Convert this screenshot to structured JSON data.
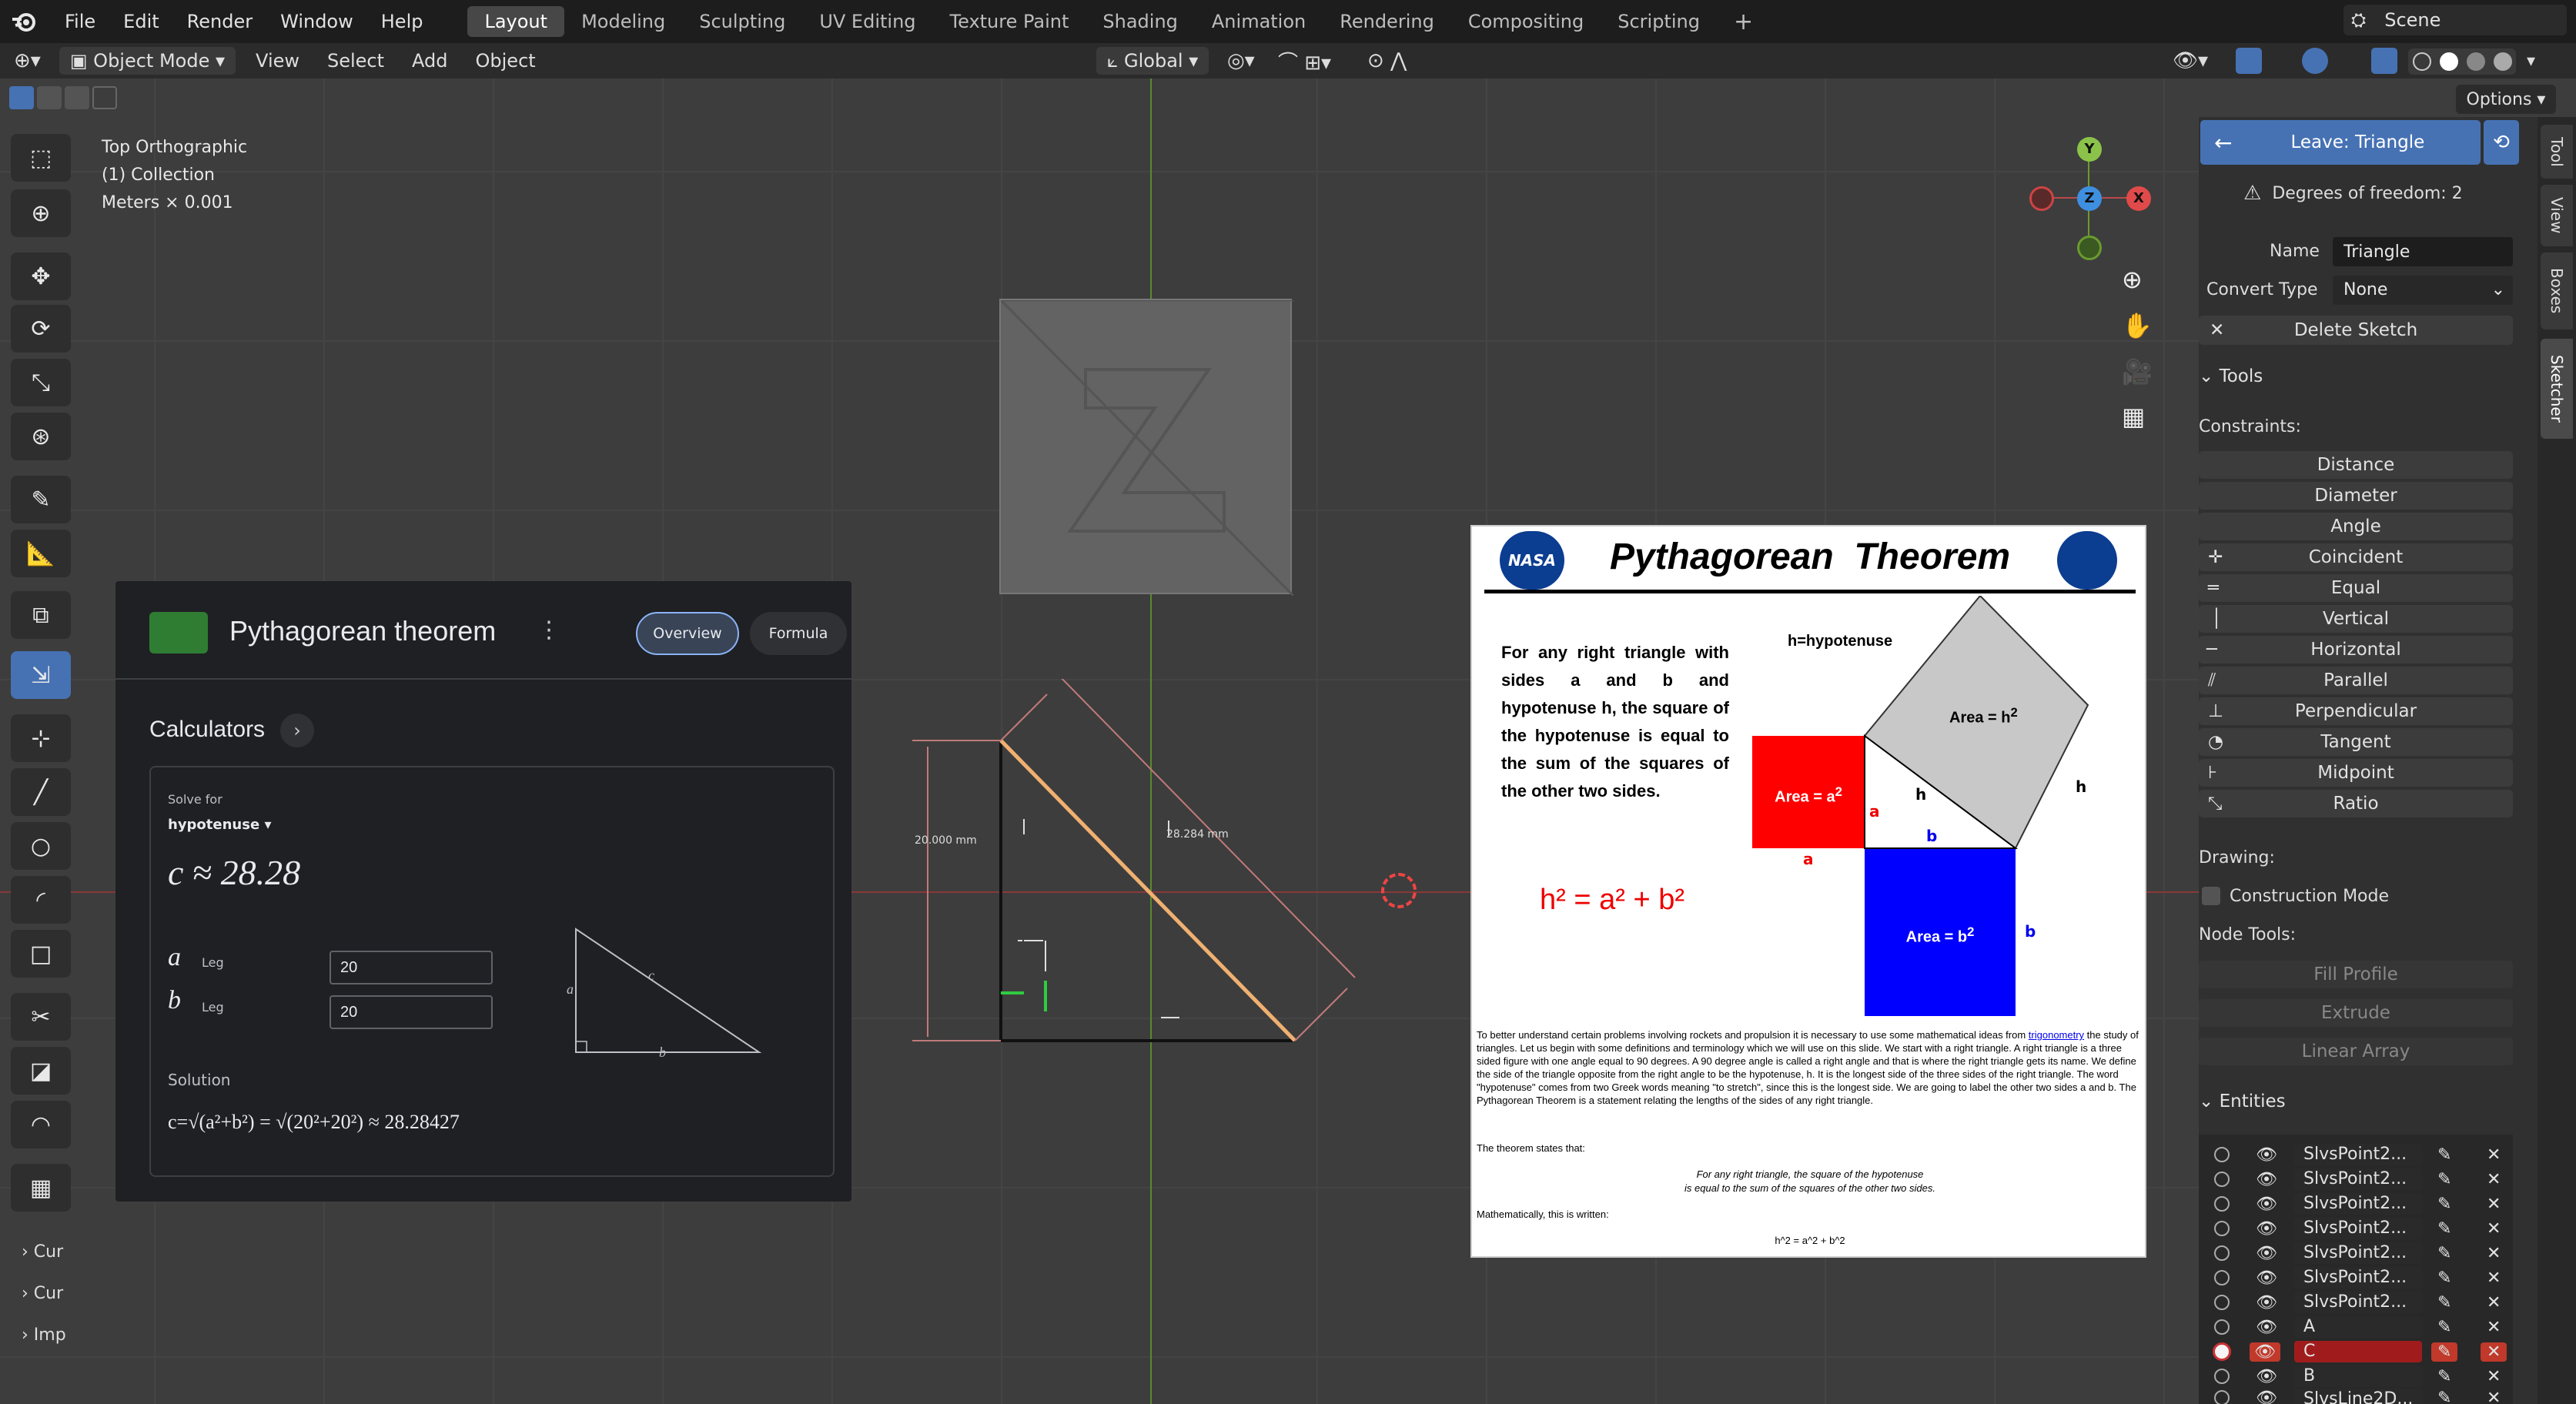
{
  "topbar": {
    "menu": [
      "File",
      "Edit",
      "Render",
      "Window",
      "Help"
    ],
    "workspaces": [
      "Layout",
      "Modeling",
      "Sculpting",
      "UV Editing",
      "Texture Paint",
      "Shading",
      "Animation",
      "Rendering",
      "Compositing",
      "Scripting"
    ],
    "active_workspace": "Layout",
    "scene_label": "Scene"
  },
  "header": {
    "mode": "Object Mode",
    "menus": [
      "View",
      "Select",
      "Add",
      "Object"
    ],
    "transform_orientation": "Global",
    "options_label": "Options"
  },
  "viewport": {
    "overlay_lines": [
      "Top Orthographic",
      "(1) Collection",
      "Meters × 0.001"
    ],
    "dim_vertical": "20.000 mm",
    "dim_diagonal": "28.284 mm",
    "gizmo": {
      "y": "Y",
      "z": "Z",
      "x": "X"
    },
    "bottom_items": [
      "Cur",
      "Cur",
      "Imp"
    ]
  },
  "google_card": {
    "title": "Pythagorean theorem",
    "tabs": [
      "Overview",
      "Formula"
    ],
    "calculators_label": "Calculators",
    "solve_for_label": "Solve for",
    "solve_for_value": "hypotenuse",
    "result": "c ≈ 28.28",
    "inputs": [
      {
        "var": "a",
        "label": "Leg",
        "value": "20"
      },
      {
        "var": "b",
        "label": "Leg",
        "value": "20"
      }
    ],
    "triangle_labels": {
      "a": "a",
      "b": "b",
      "c": "c"
    },
    "solution_label": "Solution",
    "solution_formula": "c=√(a²+b²) = √(20²+20²) ≈ 28.28427"
  },
  "poster": {
    "title": "Pythagorean  Theorem",
    "nasa": "NASA",
    "statement": "For any right triangle with sides a and b and hypotenuse h, the square of the hypotenuse is equal to the sum of the squares of the other two sides.",
    "h_label": "h=hypotenuse",
    "area_h": "Area = h",
    "area_a": "Area = a",
    "area_b": "Area = b",
    "sq": "2",
    "side_a": "a",
    "side_b": "b",
    "side_h": "h",
    "formula": "h² = a² + b²",
    "para1_pre": "To better understand certain problems involving rockets and propulsion it is necessary to use some mathematical ideas from ",
    "para1_link": "trigonometry",
    "para1_post": " the study of triangles. Let us begin with some definitions and terminology which we will use on this slide. We start with a right triangle. A right triangle is a three sided figure with one angle equal to 90 degrees. A 90 degree angle is called a right angle and that is where the right triangle gets its name. We define the side of the triangle opposite from the right angle to be the hypotenuse, h. It is the longest side of the three sides of the right triangle. The word \"hypotenuse\" comes from two Greek words meaning \"to stretch\", since this is the longest side. We are going to label the other two sides a and b. The Pythagorean Theorem is a statement relating the lengths of the sides of any right triangle.",
    "para2": "The theorem states that:",
    "quote_line1": "For any right triangle, the square of the hypotenuse",
    "quote_line2": "is equal to the sum of the squares of the other two sides.",
    "para3": "Mathematically, this is written:",
    "ascii_formula": "h^2 = a^2 + b^2"
  },
  "sidebar": {
    "leave_button": "Leave: Triangle",
    "dof": "Degrees of freedom: 2",
    "name_label": "Name",
    "name_value": "Triangle",
    "convert_label": "Convert Type",
    "convert_value": "None",
    "delete_button": "Delete Sketch",
    "tools_header": "Tools",
    "constraints_label": "Constraints:",
    "constraints": [
      "Distance",
      "Diameter",
      "Angle",
      "Coincident",
      "Equal",
      "Vertical",
      "Horizontal",
      "Parallel",
      "Perpendicular",
      "Tangent",
      "Midpoint",
      "Ratio"
    ],
    "drawing_label": "Drawing:",
    "construction_mode": "Construction Mode",
    "node_tools_label": "Node Tools:",
    "node_tools": [
      "Fill Profile",
      "Extrude",
      "Linear Array"
    ],
    "entities_header": "Entities",
    "entities": [
      "SlvsPoint2...",
      "SlvsPoint2...",
      "SlvsPoint2...",
      "SlvsPoint2...",
      "SlvsPoint2...",
      "SlvsPoint2...",
      "SlvsPoint2...",
      "A",
      "C",
      "B",
      "SlvsLine2D..."
    ],
    "selected_entity": "C",
    "tabs": [
      "Tool",
      "View",
      "Boxes",
      "Sketcher"
    ]
  }
}
